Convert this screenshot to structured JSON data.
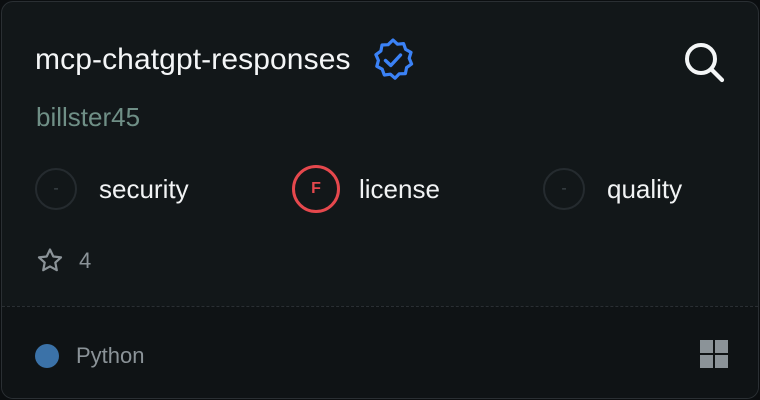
{
  "repo": {
    "name": "mcp-chatgpt-responses",
    "author": "billster45",
    "verified": true
  },
  "colors": {
    "verified_badge": "#3b82f6",
    "fail_grade": "#e5484d",
    "author_text": "#6f8f86",
    "python_language": "#3b72a8"
  },
  "scores": [
    {
      "grade": "-",
      "label": "security"
    },
    {
      "grade": "F",
      "label": "license"
    },
    {
      "grade": "-",
      "label": "quality"
    }
  ],
  "stars": {
    "count": "4"
  },
  "footer": {
    "language": "Python"
  },
  "icons": {
    "verified": "verified-badge-icon",
    "search": "search-icon",
    "star": "star-icon",
    "platform": "windows-icon"
  }
}
